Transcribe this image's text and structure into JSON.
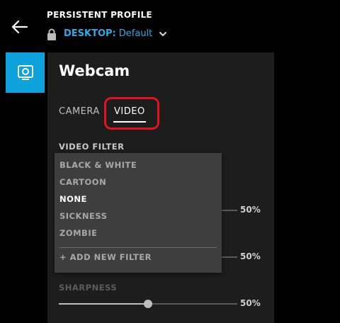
{
  "header": {
    "profile_label": "PERSISTENT PROFILE",
    "profile_prefix": "DESKTOP:",
    "profile_value": "Default"
  },
  "panel": {
    "title": "Webcam",
    "tabs": [
      {
        "label": "CAMERA",
        "active": false
      },
      {
        "label": "VIDEO",
        "active": true
      }
    ]
  },
  "video_filter": {
    "label": "VIDEO FILTER",
    "options": [
      "BLACK & WHITE",
      "CARTOON",
      "NONE",
      "SICKNESS",
      "ZOMBIE"
    ],
    "selected": "NONE",
    "add_label": "+ ADD NEW FILTER"
  },
  "sliders": [
    {
      "name": "slider-1",
      "value_label": "50%",
      "value": 0.5
    },
    {
      "name": "slider-2",
      "value_label": "50%",
      "value": 0.5
    },
    {
      "name": "sharpness",
      "label": "SHARPNESS",
      "value_label": "50%",
      "value": 0.5
    }
  ],
  "colors": {
    "accent": "#0ea2dc",
    "link": "#2fa9e8",
    "highlight": "#e0141e"
  },
  "icons": [
    "back-arrow-icon",
    "lock-icon",
    "chevron-down-icon",
    "webcam-icon"
  ]
}
